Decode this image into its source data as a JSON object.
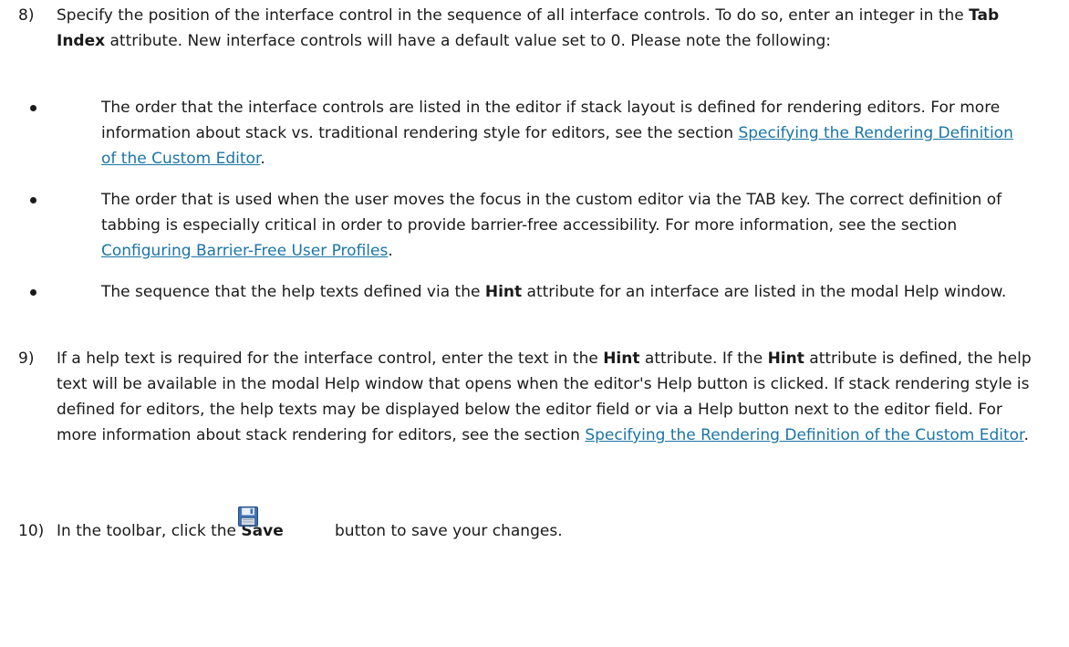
{
  "steps": [
    {
      "num": "8)",
      "parts": [
        "Specify the position of the interface control in the sequence of all interface controls. To do so, enter an integer in the ",
        "Tab Index",
        " attribute. New interface controls will have a default value set to 0. Please note the following:"
      ]
    },
    {
      "num": "9)",
      "parts": [
        "If a help text is required for the interface control, enter the text in the ",
        "Hint",
        " attribute. If the ",
        "Hint",
        " attribute is defined, the help text will be available in the modal Help window that opens when the editor's Help button is clicked. If stack rendering style is defined for editors, the help texts may be displayed below the editor field or via a Help button next to the editor field. For more information about stack rendering for editors, see the section ",
        "Specifying the Rendering Definition of the Custom Editor",
        "."
      ]
    },
    {
      "num": "10)",
      "parts": [
        "In the toolbar, click the ",
        "Save",
        " button to save your changes."
      ]
    }
  ],
  "bullets": [
    {
      "parts": [
        "The order that the interface controls are listed in the editor if stack layout is defined for rendering editors. For more information about stack vs. traditional rendering style for editors, see the section ",
        "Specifying the Rendering Definition of the Custom Editor",
        "."
      ]
    },
    {
      "parts": [
        "The order that is used when the user moves the focus in the custom editor via the TAB key. The correct definition of tabbing is especially critical in order to provide barrier-free accessibility. For more information, see the section ",
        "Configuring Barrier-Free User Profiles",
        "."
      ]
    },
    {
      "parts": [
        "The sequence that the help texts defined via the ",
        "Hint",
        " attribute for an interface are listed in the modal Help window."
      ]
    }
  ],
  "icons": {
    "save": "floppy-disk-icon"
  },
  "colors": {
    "link": "#1b75a6",
    "text": "#1a1a1a"
  }
}
